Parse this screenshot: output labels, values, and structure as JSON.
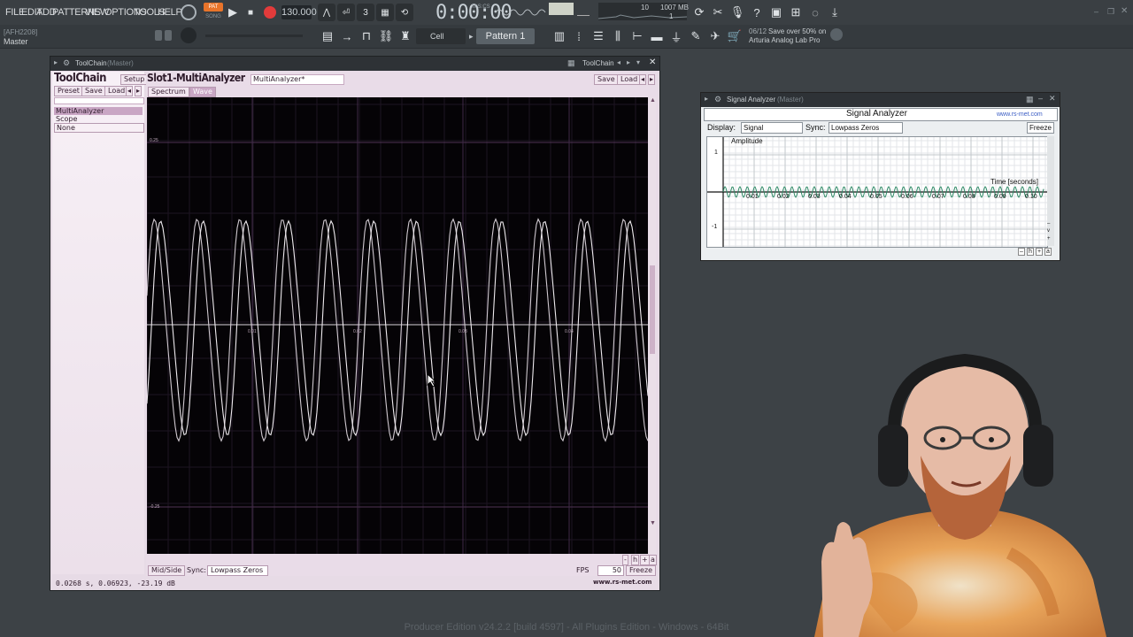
{
  "menu": [
    "FILE",
    "EDIT",
    "ADD",
    "PATTERNS",
    "VIEW",
    "OPTIONS",
    "TOOLS",
    "HELP"
  ],
  "transport": {
    "pat_label": "PAT",
    "song_label": "SONG",
    "tempo": "130.000",
    "time": "0:00:00",
    "time_unit": "M:S:CS"
  },
  "monitor": {
    "cpu": "10",
    "memory": "1007 MB",
    "voices": "1"
  },
  "hint": {
    "number": "06/12",
    "text": "Save over 50% on",
    "text2": "Arturia Analog Lab Pro"
  },
  "toolbar2": {
    "cell": "Cell",
    "pattern": "Pattern 1"
  },
  "channel": {
    "id": "[AFH2208]",
    "name": "Master"
  },
  "toolchain": {
    "window_title": "ToolChain",
    "window_sub": "(Master)",
    "window_title_right": "ToolChain",
    "heading": "ToolChain",
    "setup": "Setup",
    "preset": "Preset",
    "save": "Save",
    "load": "Load",
    "slots": [
      "MultiAnalyzer",
      "Scope",
      "None"
    ],
    "slot_title": "Slot1-MultiAnalyzer",
    "preset_name": "MultiAnalyzer*",
    "slot_save": "Save",
    "slot_load": "Load",
    "tabs": [
      "Spectrum",
      "Wave"
    ],
    "mid_side": "Mid/Side",
    "sync_label": "Sync:",
    "sync_value": "Lowpass Zeros",
    "fps_label": "FPS",
    "fps_value": "50",
    "freeze": "Freeze",
    "url": "www.rs-met.com",
    "status": "0.0268 s, 0.06923, -23.19 dB",
    "y_ticks": [
      "0.25",
      "-0.25"
    ],
    "x_ticks": [
      "0.01",
      "0.02",
      "0.03",
      "0.04"
    ],
    "zoom_buttons": [
      "-",
      "h",
      "+",
      "a"
    ]
  },
  "signal_analyzer": {
    "window_title": "Signal Analyzer",
    "window_sub": "(Master)",
    "heading": "Signal Analyzer",
    "url": "www.rs-met.com",
    "display_label": "Display:",
    "display_value": "Signal",
    "sync_label": "Sync:",
    "sync_value": "Lowpass Zeros",
    "freeze": "Freeze",
    "amplitude_label": "Amplitude",
    "time_label": "Time [seconds]",
    "y_ticks": [
      "1",
      "-1"
    ],
    "x_ticks": [
      "0.01",
      "0.02",
      "0.03",
      "0.04",
      "0.05",
      "0.06",
      "0.07",
      "0.08",
      "0.09",
      "0.10"
    ]
  },
  "footer": "Producer Edition v24.2.2 [build 4597] - All Plugins Edition - Windows - 64Bit",
  "colors": {
    "app_bg": "#3d4246",
    "plugin_pink": "#e7dbe6",
    "wave": "#e6e0e6",
    "grid": "#3a2640",
    "sa_wave": "#2e8a66",
    "record": "#e23b3b"
  }
}
